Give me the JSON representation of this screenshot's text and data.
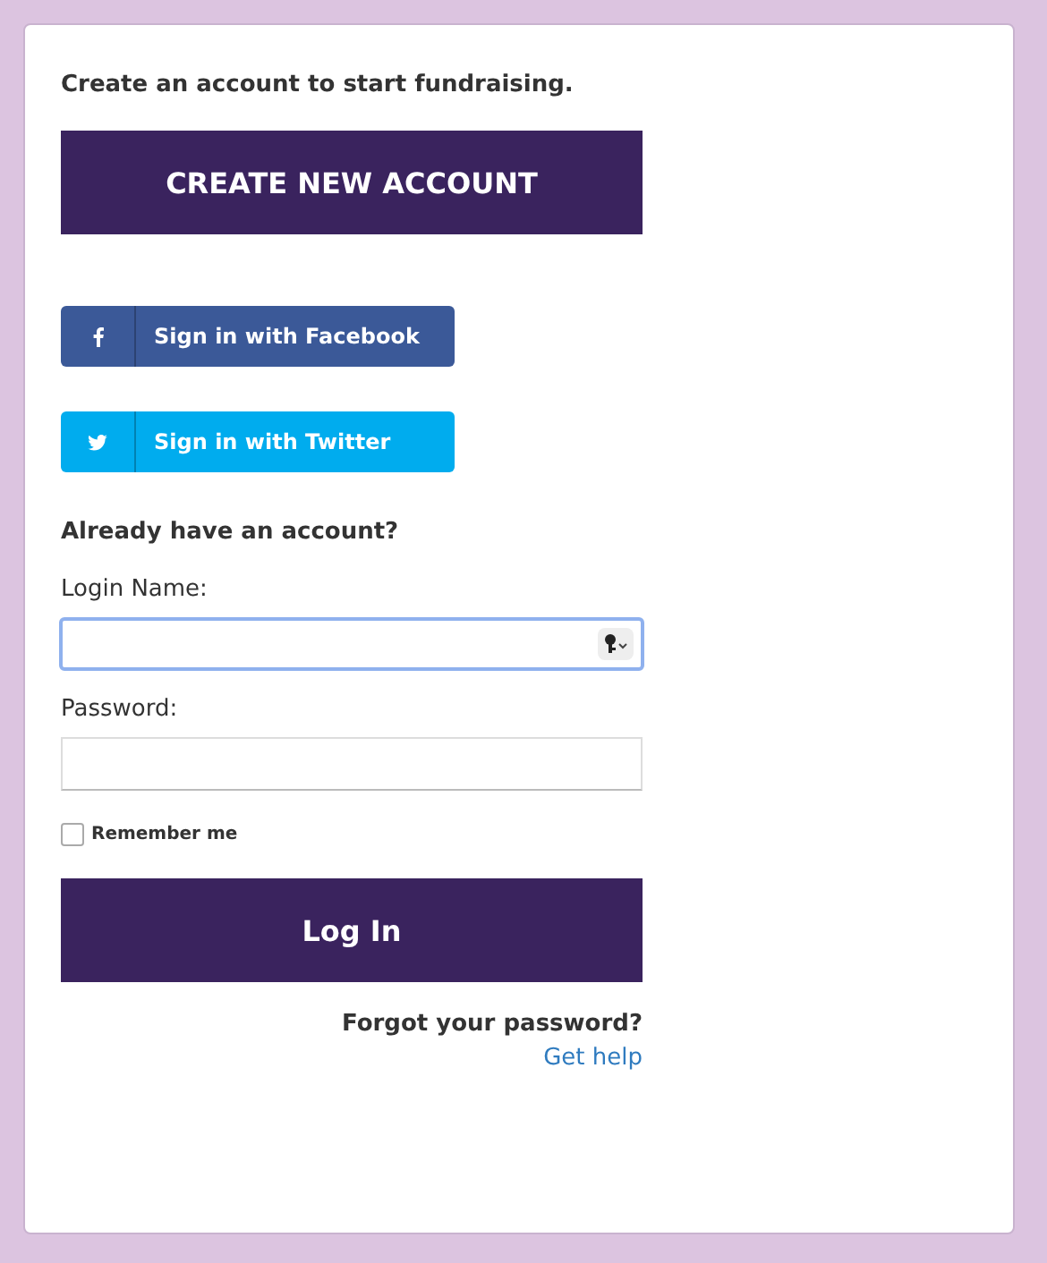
{
  "intro": "Create an account to start fundraising.",
  "create_button": "CREATE NEW ACCOUNT",
  "social_buttons": [
    {
      "kind": "facebook",
      "label": "Sign in with Facebook",
      "color": "#3b5998"
    },
    {
      "kind": "twitter",
      "label": "Sign in with Twitter",
      "color": "#00acee"
    }
  ],
  "login_heading": "Already have an account?",
  "fields": [
    {
      "label": "Login Name:",
      "focused": true,
      "key_button": true
    },
    {
      "label": "Password:",
      "focused": false,
      "key_button": false
    }
  ],
  "remember": {
    "label": "Remember me",
    "checked": false
  },
  "login_button": "Log In",
  "forgot": {
    "text": "Forgot your password?",
    "link": "Get help"
  }
}
